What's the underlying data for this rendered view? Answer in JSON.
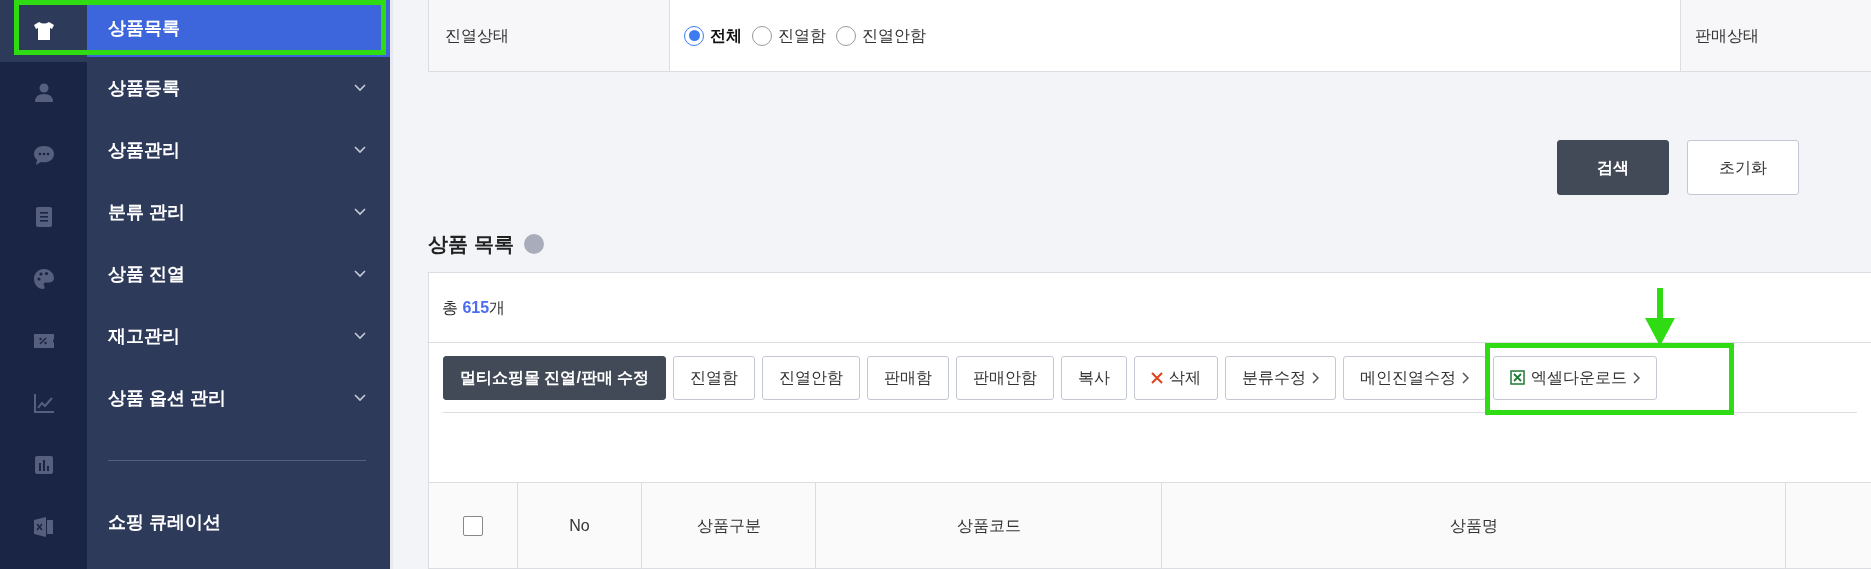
{
  "sidebar": {
    "items": [
      {
        "label": "상품목록",
        "selected": true,
        "expandable": false
      },
      {
        "label": "상품등록",
        "selected": false,
        "expandable": true
      },
      {
        "label": "상품관리",
        "selected": false,
        "expandable": true
      },
      {
        "label": "분류 관리",
        "selected": false,
        "expandable": true
      },
      {
        "label": "상품 진열",
        "selected": false,
        "expandable": true
      },
      {
        "label": "재고관리",
        "selected": false,
        "expandable": true
      },
      {
        "label": "상품 옵션 관리",
        "selected": false,
        "expandable": true
      },
      {
        "kind": "divider"
      },
      {
        "label": "쇼핑 큐레이션",
        "selected": false,
        "expandable": false
      }
    ]
  },
  "filter": {
    "label": "진열상태",
    "options": [
      {
        "label": "전체",
        "selected": true
      },
      {
        "label": "진열함",
        "selected": false
      },
      {
        "label": "진열안함",
        "selected": false
      }
    ],
    "next_label": "판매상태"
  },
  "search_buttons": [
    {
      "label": "검색",
      "kind": "primary"
    },
    {
      "label": "초기화",
      "kind": "secondary"
    }
  ],
  "list": {
    "title": "상품 목록",
    "total_prefix": "총 ",
    "total": "615",
    "total_suffix": "개",
    "actions": [
      {
        "label": "멀티쇼핑몰 진열/판매 수정",
        "kind": "primary"
      },
      {
        "label": "진열함",
        "kind": "plain"
      },
      {
        "label": "진열안함",
        "kind": "plain"
      },
      {
        "label": "판매함",
        "kind": "plain"
      },
      {
        "label": "판매안함",
        "kind": "plain"
      },
      {
        "label": "복사",
        "kind": "plain"
      },
      {
        "label": "삭제",
        "kind": "delete"
      },
      {
        "label": "분류수정",
        "kind": "more"
      },
      {
        "label": "메인진열수정",
        "kind": "more"
      },
      {
        "label": "엑셀다운로드",
        "kind": "excel",
        "highlighted": true
      }
    ],
    "columns": [
      {
        "kind": "checkbox",
        "checked": false
      },
      {
        "label": "No"
      },
      {
        "label": "상품구분"
      },
      {
        "label": "상품코드"
      },
      {
        "label": "상품명"
      }
    ]
  }
}
